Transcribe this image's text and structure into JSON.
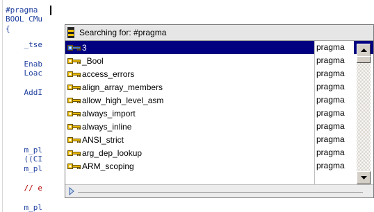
{
  "editor": {
    "lines": [
      {
        "text": "#pragma ",
        "color": "blue"
      },
      {
        "text": "BOOL CMu",
        "color": "blue"
      },
      {
        "text": "{",
        "color": "blue"
      },
      {
        "text": "    _tse",
        "color": "blue"
      },
      {
        "text": "    Enab",
        "color": "blue"
      },
      {
        "text": "    Loac",
        "color": "blue"
      },
      {
        "text": "    AddI",
        "color": "blue"
      },
      {
        "text": "    m_pl",
        "color": "blue"
      },
      {
        "text": "    ((CI",
        "color": "blue"
      },
      {
        "text": "    m_pl",
        "color": "blue"
      },
      {
        "text": "    // e",
        "color": "red"
      },
      {
        "text": "    m_pl",
        "color": "blue"
      }
    ]
  },
  "popup": {
    "header": "Searching for: #pragma",
    "selected_index": 0,
    "items": [
      {
        "name": "3",
        "type": "pragma"
      },
      {
        "name": "_Bool",
        "type": "pragma"
      },
      {
        "name": "access_errors",
        "type": "pragma"
      },
      {
        "name": "align_array_members",
        "type": "pragma"
      },
      {
        "name": "allow_high_level_asm",
        "type": "pragma"
      },
      {
        "name": "always_import",
        "type": "pragma"
      },
      {
        "name": "always_inline",
        "type": "pragma"
      },
      {
        "name": "ANSI_strict",
        "type": "pragma"
      },
      {
        "name": "arg_dep_lookup",
        "type": "pragma"
      },
      {
        "name": "ARM_scoping",
        "type": "pragma"
      }
    ],
    "icon": "key-icon",
    "colors": {
      "selection": "#000080",
      "key_icon": "#e8b800"
    }
  }
}
